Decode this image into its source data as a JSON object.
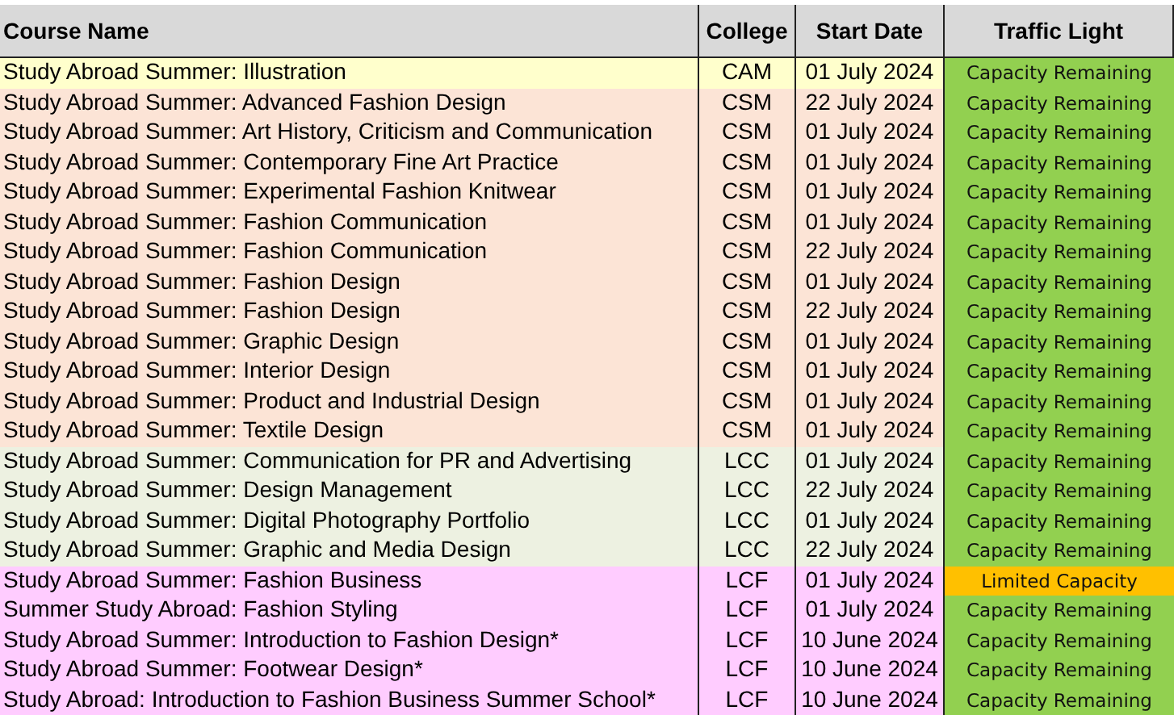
{
  "table": {
    "columns": [
      "Course Name",
      "College",
      "Start Date",
      "Traffic Light"
    ],
    "rows": [
      {
        "course": "Study Abroad Summer: Illustration",
        "college": "CAM",
        "start_date": "01 July 2024",
        "color": "#ffffcc",
        "status": {
          "label": "Capacity Remaining",
          "color": "#92d050"
        }
      },
      {
        "course": "Study Abroad Summer: Advanced Fashion Design",
        "college": "CSM",
        "start_date": "22 July 2024",
        "color": "#fce4d6",
        "status": {
          "label": "Capacity Remaining",
          "color": "#92d050"
        }
      },
      {
        "course": "Study Abroad Summer: Art History, Criticism and Communication",
        "college": "CSM",
        "start_date": "01 July 2024",
        "color": "#fce4d6",
        "status": {
          "label": "Capacity Remaining",
          "color": "#92d050"
        }
      },
      {
        "course": "Study Abroad Summer: Contemporary Fine Art Practice",
        "college": "CSM",
        "start_date": "01 July 2024",
        "color": "#fce4d6",
        "status": {
          "label": "Capacity Remaining",
          "color": "#92d050"
        }
      },
      {
        "course": "Study Abroad Summer: Experimental Fashion Knitwear",
        "college": "CSM",
        "start_date": "01 July 2024",
        "color": "#fce4d6",
        "status": {
          "label": "Capacity Remaining",
          "color": "#92d050"
        }
      },
      {
        "course": "Study Abroad Summer: Fashion Communication",
        "college": "CSM",
        "start_date": "01 July 2024",
        "color": "#fce4d6",
        "status": {
          "label": "Capacity Remaining",
          "color": "#92d050"
        }
      },
      {
        "course": "Study Abroad Summer: Fashion Communication",
        "college": "CSM",
        "start_date": "22 July 2024",
        "color": "#fce4d6",
        "status": {
          "label": "Capacity Remaining",
          "color": "#92d050"
        }
      },
      {
        "course": "Study Abroad Summer: Fashion Design",
        "college": "CSM",
        "start_date": "01 July 2024",
        "color": "#fce4d6",
        "status": {
          "label": "Capacity Remaining",
          "color": "#92d050"
        }
      },
      {
        "course": "Study Abroad Summer: Fashion Design",
        "college": "CSM",
        "start_date": "22 July 2024",
        "color": "#fce4d6",
        "status": {
          "label": "Capacity Remaining",
          "color": "#92d050"
        }
      },
      {
        "course": "Study Abroad Summer: Graphic Design",
        "college": "CSM",
        "start_date": "01 July 2024",
        "color": "#fce4d6",
        "status": {
          "label": "Capacity Remaining",
          "color": "#92d050"
        }
      },
      {
        "course": "Study Abroad Summer: Interior Design",
        "college": "CSM",
        "start_date": "01 July 2024",
        "color": "#fce4d6",
        "status": {
          "label": "Capacity Remaining",
          "color": "#92d050"
        }
      },
      {
        "course": "Study Abroad Summer: Product and Industrial Design",
        "college": "CSM",
        "start_date": "01 July 2024",
        "color": "#fce4d6",
        "status": {
          "label": "Capacity Remaining",
          "color": "#92d050"
        }
      },
      {
        "course": "Study Abroad Summer: Textile Design",
        "college": "CSM",
        "start_date": "01 July 2024",
        "color": "#fce4d6",
        "status": {
          "label": "Capacity Remaining",
          "color": "#92d050"
        }
      },
      {
        "course": "Study Abroad Summer: Communication for PR and Advertising",
        "college": "LCC",
        "start_date": "01 July 2024",
        "color": "#edf1e1",
        "status": {
          "label": "Capacity Remaining",
          "color": "#92d050"
        }
      },
      {
        "course": "Study Abroad Summer: Design Management",
        "college": "LCC",
        "start_date": "22 July 2024",
        "color": "#edf1e1",
        "status": {
          "label": "Capacity Remaining",
          "color": "#92d050"
        }
      },
      {
        "course": "Study Abroad Summer: Digital Photography Portfolio",
        "college": "LCC",
        "start_date": "01 July 2024",
        "color": "#edf1e1",
        "status": {
          "label": "Capacity Remaining",
          "color": "#92d050"
        }
      },
      {
        "course": "Study Abroad Summer: Graphic and Media Design",
        "college": "LCC",
        "start_date": "22 July 2024",
        "color": "#edf1e1",
        "status": {
          "label": "Capacity Remaining",
          "color": "#92d050"
        }
      },
      {
        "course": "Study Abroad Summer: Fashion Business",
        "college": "LCF",
        "start_date": "01 July 2024",
        "color": "#ffccff",
        "status": {
          "label": "Limited Capacity",
          "color": "#ffc000"
        }
      },
      {
        "course": "Summer Study Abroad: Fashion Styling",
        "college": "LCF",
        "start_date": "01 July 2024",
        "color": "#ffccff",
        "status": {
          "label": "Capacity Remaining",
          "color": "#92d050"
        }
      },
      {
        "course": "Study Abroad Summer: Introduction to Fashion Design*",
        "college": "LCF",
        "start_date": "10 June 2024",
        "color": "#ffccff",
        "status": {
          "label": "Capacity Remaining",
          "color": "#92d050"
        }
      },
      {
        "course": "Study Abroad Summer: Footwear Design*",
        "college": "LCF",
        "start_date": "10 June 2024",
        "color": "#ffccff",
        "status": {
          "label": "Capacity Remaining",
          "color": "#92d050"
        }
      },
      {
        "course": "Study Abroad: Introduction to Fashion Business Summer School*",
        "college": "LCF",
        "start_date": "10 June 2024",
        "color": "#ffccff",
        "status": {
          "label": "Capacity Remaining",
          "color": "#92d050"
        }
      }
    ]
  }
}
